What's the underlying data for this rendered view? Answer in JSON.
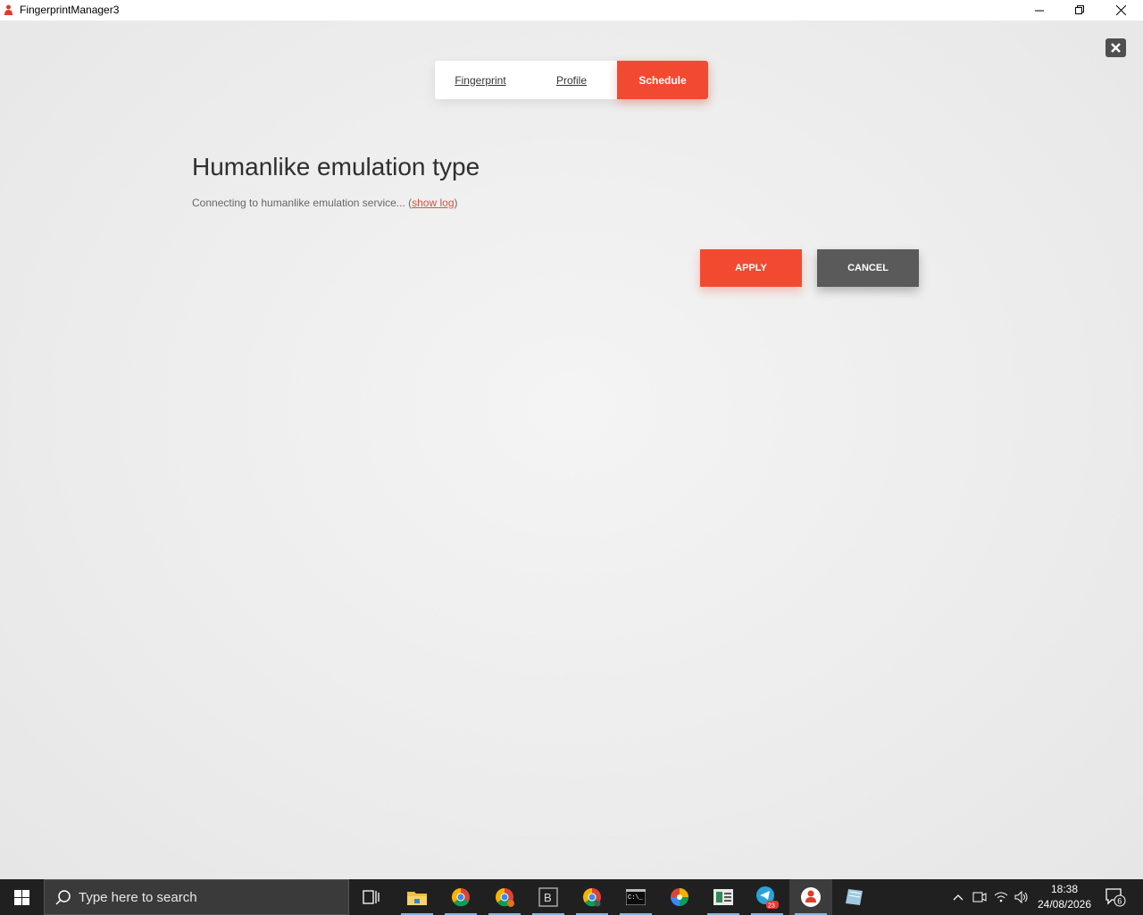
{
  "window": {
    "title": "FingerprintManager3"
  },
  "tabs": [
    {
      "label": "Fingerprint"
    },
    {
      "label": "Profile"
    },
    {
      "label": "Schedule"
    }
  ],
  "content": {
    "heading": "Humanlike emulation type",
    "status_prefix": "Connecting to humanlike emulation service... (",
    "status_link": "show log",
    "status_suffix": ")"
  },
  "buttons": {
    "apply": "APPLY",
    "cancel": "CANCEL"
  },
  "taskbar": {
    "search_placeholder": "Type here to search",
    "time": "18:38",
    "date": "24/08/2026",
    "notification_count": "6",
    "telegram_badge": "23"
  },
  "colors": {
    "accent": "#f24a30",
    "cancel": "#5a5a5a",
    "taskbar": "#202020"
  }
}
